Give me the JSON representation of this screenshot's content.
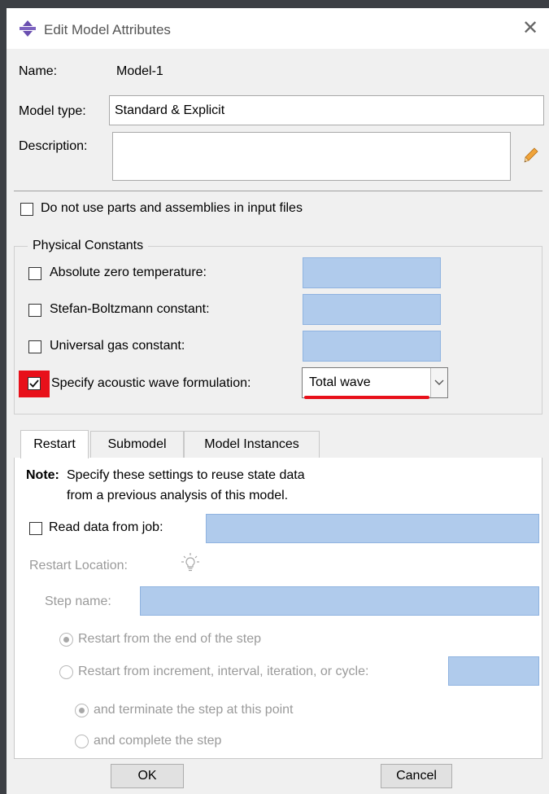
{
  "window": {
    "title": "Edit Model Attributes",
    "close_glyph": "✕"
  },
  "name_row": {
    "label": "Name:",
    "value": "Model-1"
  },
  "model_type": {
    "label": "Model type:",
    "value": "Standard & Explicit"
  },
  "description": {
    "label": "Description:",
    "value": ""
  },
  "no_parts_option": {
    "label": "Do not use parts and assemblies in input files",
    "checked": false
  },
  "physical_constants": {
    "legend": "Physical Constants",
    "absolute_zero": {
      "label": "Absolute zero temperature:",
      "checked": false
    },
    "stefan_boltzmann": {
      "label": "Stefan-Boltzmann constant:",
      "checked": false
    },
    "gas_constant": {
      "label": "Universal gas constant:",
      "checked": false
    },
    "acoustic_wave": {
      "label": "Specify acoustic wave formulation:",
      "checked": true,
      "selected": "Total wave"
    }
  },
  "tabs": [
    {
      "label": "Restart",
      "active": true
    },
    {
      "label": "Submodel",
      "active": false
    },
    {
      "label": "Model Instances",
      "active": false
    }
  ],
  "restart": {
    "note_label": "Note:",
    "note_line1": "Specify these settings to reuse state data",
    "note_line2": "from a previous analysis of this model.",
    "read_data_label": "Read data from job:",
    "read_data_checked": false,
    "location_label": "Restart Location:",
    "step_name_label": "Step name:",
    "radio_end_of_step": "Restart from the end of the step",
    "radio_increment": "Restart from increment, interval, iteration, or cycle:",
    "radio_terminate": "and terminate the step at this point",
    "radio_complete": "and complete the step"
  },
  "buttons": {
    "ok": "OK",
    "cancel": "Cancel"
  },
  "annotation_color": "#e8101a"
}
